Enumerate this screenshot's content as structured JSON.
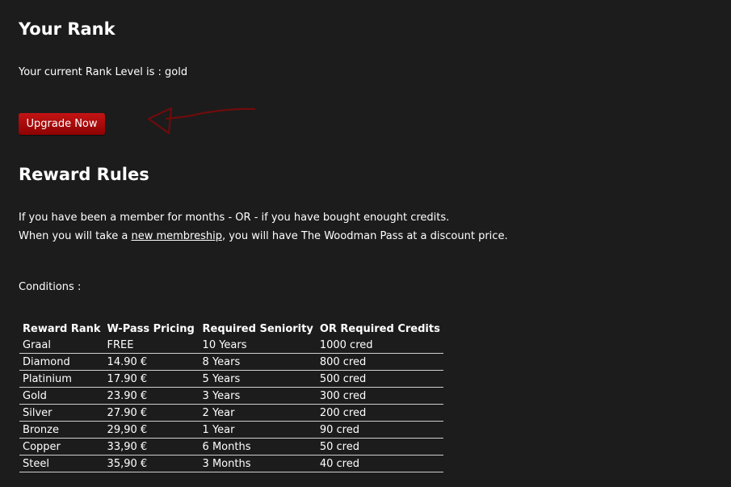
{
  "rank": {
    "heading": "Your Rank",
    "current_prefix": "Your current Rank Level is : ",
    "current_value": "gold",
    "upgrade_label": "Upgrade Now",
    "arrow_color": "#6e0c0c"
  },
  "rules": {
    "heading": "Reward Rules",
    "line1": "If you have been a member for months - OR - if you have bought enought credits.",
    "line2_before": "When you will take a ",
    "line2_link": "new membreship",
    "line2_after": ", you will have The Woodman Pass at a discount price.",
    "conditions_label": "Conditions :"
  },
  "table": {
    "headers": [
      "Reward Rank",
      "W-Pass Pricing",
      "Required Seniority",
      "OR Required Credits"
    ],
    "rows": [
      [
        "Graal",
        "FREE",
        "10 Years",
        "1000 cred"
      ],
      [
        "Diamond",
        "14.90 €",
        "8 Years",
        "800 cred"
      ],
      [
        "Platinium",
        "17.90 €",
        "5 Years",
        "500 cred"
      ],
      [
        "Gold",
        "23.90 €",
        "3 Years",
        "300 cred"
      ],
      [
        "Silver",
        "27.90 €",
        "2 Year",
        "200 cred"
      ],
      [
        "Bronze",
        "29,90 €",
        "1 Year",
        "90 cred"
      ],
      [
        "Copper",
        "33,90 €",
        "6 Months",
        "50 cred"
      ],
      [
        "Steel",
        "35,90 €",
        "3 Months",
        "40 cred"
      ]
    ]
  },
  "colors": {
    "background": "#1c1c1c",
    "button_red": "#b00c0c",
    "text": "#ffffff"
  }
}
